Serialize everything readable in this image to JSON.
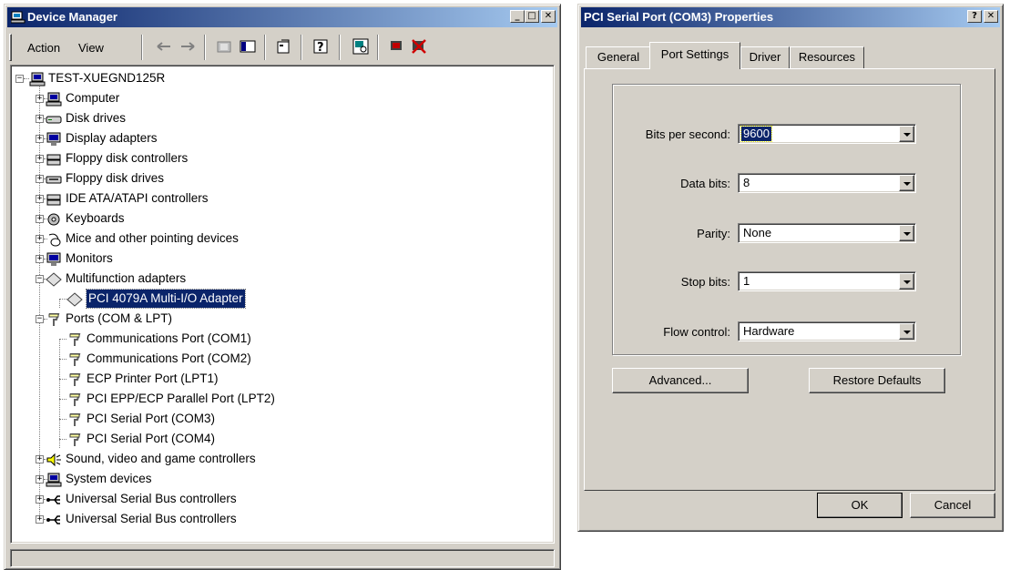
{
  "device_manager": {
    "title": "Device Manager",
    "menu": {
      "action": "Action",
      "view": "View"
    },
    "tree": {
      "root": "TEST-XUEGND125R",
      "items": [
        "Computer",
        "Disk drives",
        "Display adapters",
        "Floppy disk controllers",
        "Floppy disk drives",
        "IDE ATA/ATAPI controllers",
        "Keyboards",
        "Mice and other pointing devices",
        "Monitors",
        "Multifunction adapters",
        "PCI 4079A Multi-I/O Adapter",
        "Ports (COM & LPT)",
        "Communications Port (COM1)",
        "Communications Port (COM2)",
        "ECP Printer Port (LPT1)",
        "PCI EPP/ECP Parallel Port (LPT2)",
        "PCI Serial Port (COM3)",
        "PCI Serial Port (COM4)",
        "Sound, video and game controllers",
        "System devices",
        "Universal Serial Bus controllers",
        "Universal Serial Bus controllers"
      ]
    }
  },
  "properties": {
    "title": "PCI Serial Port (COM3) Properties",
    "tabs": [
      "General",
      "Port Settings",
      "Driver",
      "Resources"
    ],
    "active_tab": "Port Settings",
    "fields": {
      "bits_label": "Bits per second:",
      "bits_value": "9600",
      "data_label": "Data bits:",
      "data_value": "8",
      "parity_label": "Parity:",
      "parity_value": "None",
      "stop_label": "Stop bits:",
      "stop_value": "1",
      "flow_label": "Flow control:",
      "flow_value": "Hardware"
    },
    "buttons": {
      "advanced": "Advanced...",
      "restore": "Restore Defaults",
      "ok": "OK",
      "cancel": "Cancel"
    }
  },
  "colors": {
    "title_active": "#0a246a",
    "title_gradient_end": "#a6caf0",
    "face": "#d4d0c8",
    "selection": "#0a246a"
  }
}
